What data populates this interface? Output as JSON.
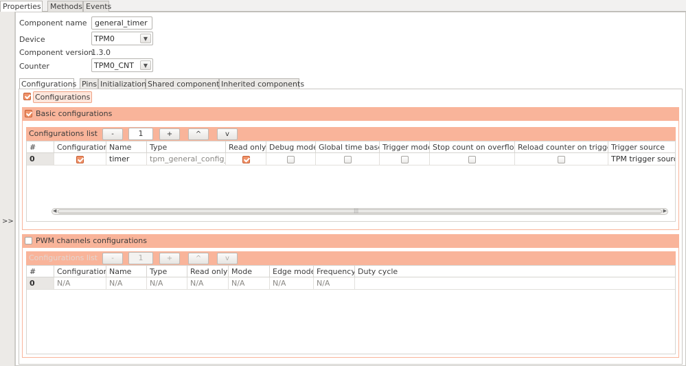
{
  "window": {
    "tabs": [
      "Properties",
      "Methods",
      "Events"
    ],
    "collapse_label": ">>"
  },
  "form": {
    "component_name_label": "Component name",
    "component_name_value": "general_timer",
    "device_label": "Device",
    "device_value": "TPM0",
    "component_version_label": "Component version",
    "component_version_value": "1.3.0",
    "counter_label": "Counter",
    "counter_value": "TPM0_CNT"
  },
  "inner_tabs": [
    "Configurations",
    "Pins",
    "Initialization",
    "Shared components",
    "Inherited components"
  ],
  "configurations": {
    "label": "Configurations",
    "checked": true
  },
  "basic": {
    "title": "Basic configurations",
    "checked": true,
    "list_title": "Configurations list",
    "btn_minus": "-",
    "count": "1",
    "btn_plus": "+",
    "btn_up": "^",
    "btn_down": "v",
    "columns": [
      "#",
      "Configuration",
      "Name",
      "Type",
      "Read only",
      "Debug mode",
      "Global time base",
      "Trigger mode",
      "Stop count on overflow",
      "Reload counter on trigger",
      "Trigger source"
    ],
    "rows": [
      {
        "index": "0",
        "configuration": true,
        "name": "timer",
        "type": "tpm_general_config_t",
        "read_only": true,
        "debug_mode": false,
        "global_time_base": false,
        "trigger_mode": false,
        "stop_count_on_overflow": false,
        "reload_counter_on_trigger": false,
        "trigger_source": "TPM trigger source"
      }
    ],
    "scroll_mark": "|||"
  },
  "pwm": {
    "title": "PWM channels configurations",
    "checked": false,
    "list_title": "Configurations list",
    "btn_minus": "-",
    "count": "1",
    "btn_plus": "+",
    "btn_up": "^",
    "btn_down": "v",
    "columns": [
      "#",
      "Configuration",
      "Name",
      "Type",
      "Read only",
      "Mode",
      "Edge mode",
      "Frequency",
      "Duty cycle"
    ],
    "rows": [
      {
        "index": "0",
        "cells": [
          "N/A",
          "N/A",
          "N/A",
          "N/A",
          "N/A",
          "N/A",
          "N/A"
        ]
      }
    ]
  },
  "colors": {
    "accent": "#f9b49a",
    "checkbox_checked": "#f0936a"
  }
}
